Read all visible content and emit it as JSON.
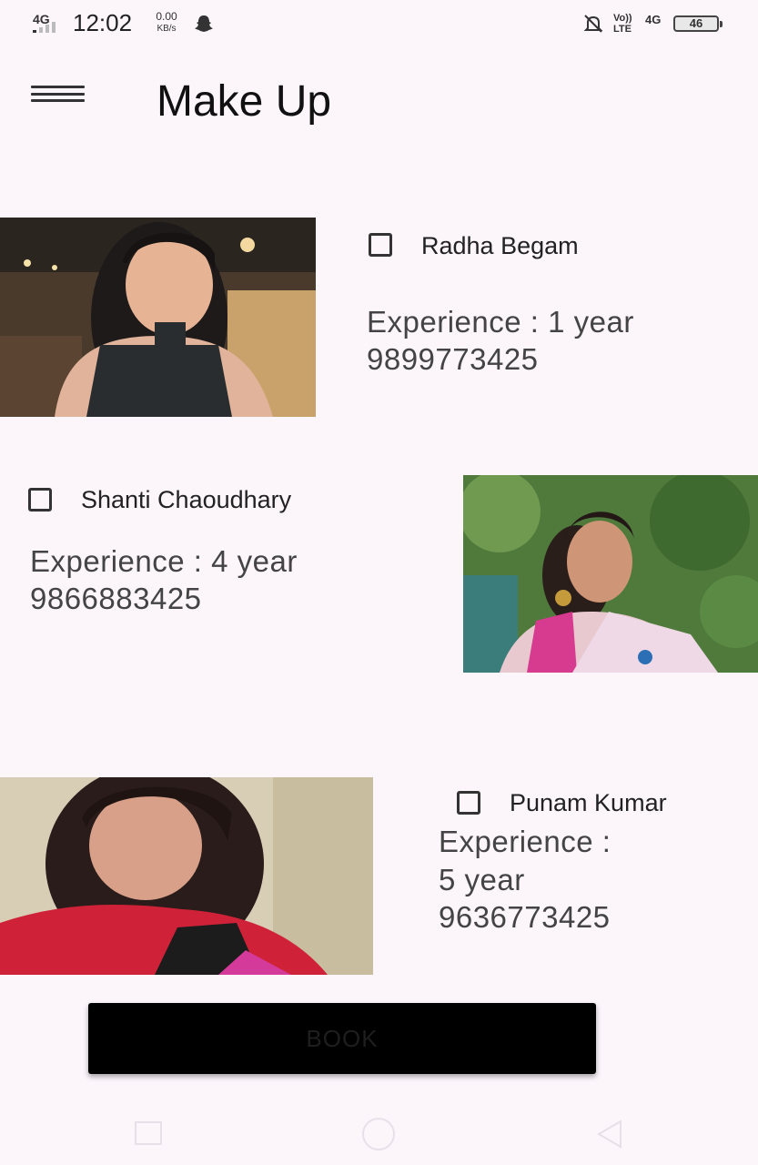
{
  "status_bar": {
    "network": "4G",
    "time": "12:02",
    "speed_value": "0.00",
    "speed_unit": "KB/s",
    "volte_top": "Vo))",
    "volte_bottom": "LTE",
    "network2": "4G",
    "battery": "46"
  },
  "app_bar": {
    "title": "Make Up"
  },
  "artists": [
    {
      "name": "Radha Begam",
      "experience": "Experience : 1 year",
      "phone": "9899773425",
      "checked": false
    },
    {
      "name": "Shanti Chaoudhary",
      "experience": "Experience : 4 year",
      "phone": "9866883425",
      "checked": false
    },
    {
      "name": "Punam Kumar",
      "experience_line1": "Experience :",
      "experience_line2": "5 year",
      "phone": "9636773425",
      "checked": false
    }
  ],
  "book_button": {
    "label": "BOOK"
  },
  "colors": {
    "background": "#fcf6fb",
    "button": "#000000",
    "text": "#1a1a1a"
  },
  "icons": {
    "menu": "hamburger-icon",
    "nav": [
      "square-icon",
      "circle-icon",
      "triangle-back-icon"
    ]
  }
}
